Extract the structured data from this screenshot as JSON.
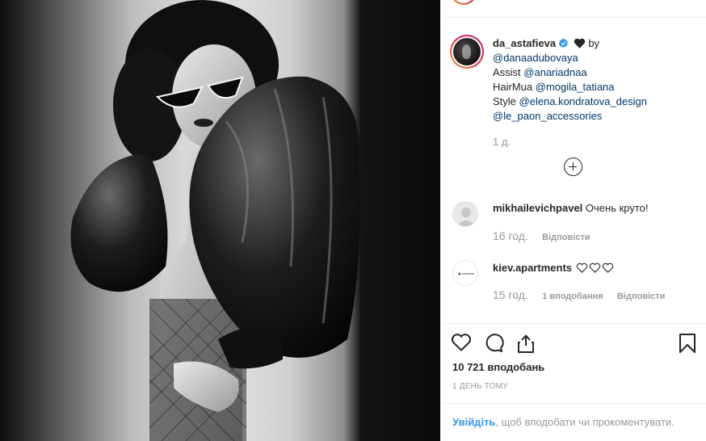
{
  "post": {
    "photo": {
      "icon": "portrait-photo",
      "description_icon": "woman-in-sunglasses-black-balloon-sleeve-photo"
    },
    "author": {
      "username": "da_astafieva",
      "verified": true
    },
    "caption": {
      "after_user": "by",
      "lines": [
        {
          "prefix": "",
          "mention": "@danaadubovaya"
        },
        {
          "prefix": "Assist ",
          "mention": "@anariadnaa"
        },
        {
          "prefix": "HairMua ",
          "mention": "@mogila_tatiana"
        },
        {
          "prefix": "Style ",
          "mention": "@elena.kondratova_design"
        },
        {
          "prefix": "",
          "mention": "@le_paon_accessories"
        }
      ],
      "time": "1 д."
    },
    "comments": [
      {
        "username": "mikhailevichpavel",
        "text": "Очень круто!",
        "time": "16 год.",
        "likes": "",
        "reply": "Відповісти"
      },
      {
        "username": "kiev.apartments",
        "text": "",
        "hearts": 3,
        "time": "15 год.",
        "likes": "1 вподобання",
        "reply": "Відповісти"
      }
    ],
    "likes_count": "10 721 вподобань",
    "posted_ago": "1 ДЕНЬ ТОМУ",
    "login_prompt": {
      "link": "Увійдіть",
      "rest": ", щоб вподобати чи прокоментувати."
    },
    "colors": {
      "link": "#003569",
      "login_link": "#3897f0",
      "muted": "#999999",
      "verified": "#3897f0"
    }
  }
}
